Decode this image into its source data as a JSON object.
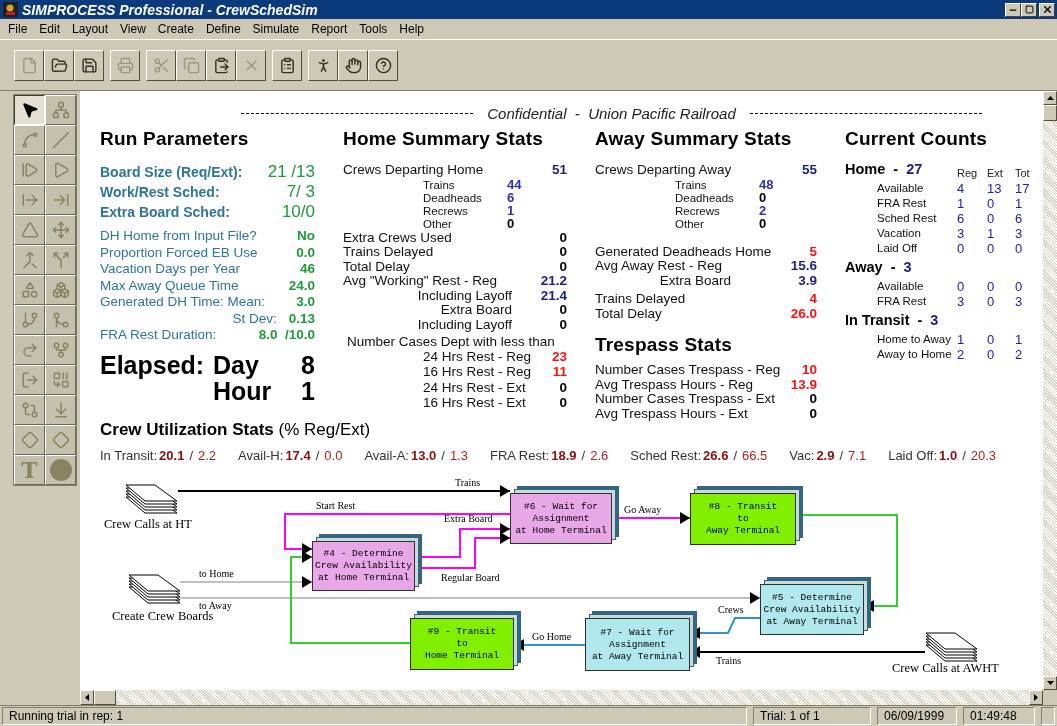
{
  "window": {
    "title": "SIMPROCESS Professional - CrewSchedSim"
  },
  "menu": [
    "File",
    "Edit",
    "Layout",
    "View",
    "Create",
    "Define",
    "Simulate",
    "Report",
    "Tools",
    "Help"
  ],
  "toolbar": [
    [
      {
        "kind": "new",
        "disabled": true
      },
      {
        "kind": "open",
        "disabled": false
      },
      {
        "kind": "save",
        "disabled": false
      }
    ],
    [
      {
        "kind": "print",
        "disabled": true
      }
    ],
    [
      {
        "kind": "cut",
        "disabled": true
      },
      {
        "kind": "copy",
        "disabled": true
      },
      {
        "kind": "paste",
        "disabled": false
      },
      {
        "kind": "delete",
        "disabled": true
      }
    ],
    [
      {
        "kind": "properties",
        "disabled": false
      }
    ],
    [
      {
        "kind": "run",
        "disabled": false
      },
      {
        "kind": "hand",
        "disabled": false
      },
      {
        "kind": "help",
        "disabled": false
      }
    ]
  ],
  "palette": [
    {
      "kind": "pointer",
      "selected": true
    },
    {
      "kind": "layout",
      "selected": false
    },
    {
      "kind": "connector",
      "selected": false
    },
    {
      "kind": "line",
      "selected": false
    },
    {
      "kind": "step",
      "selected": false
    },
    {
      "kind": "play",
      "selected": false
    },
    {
      "kind": "entry",
      "selected": false
    },
    {
      "kind": "exit",
      "selected": false
    },
    {
      "kind": "delay",
      "selected": false
    },
    {
      "kind": "branch",
      "selected": false
    },
    {
      "kind": "merge",
      "selected": false
    },
    {
      "kind": "split",
      "selected": false
    },
    {
      "kind": "assign",
      "selected": false
    },
    {
      "kind": "release",
      "selected": false
    },
    {
      "kind": "fork",
      "selected": false
    },
    {
      "kind": "join",
      "selected": false
    },
    {
      "kind": "get",
      "selected": false
    },
    {
      "kind": "gitfork",
      "selected": false
    },
    {
      "kind": "gate",
      "selected": false
    },
    {
      "kind": "transform",
      "selected": false
    },
    {
      "kind": "batch",
      "selected": false
    },
    {
      "kind": "dispose",
      "selected": false
    },
    {
      "kind": "decision",
      "selected": false
    },
    {
      "kind": "decision",
      "selected": false
    },
    {
      "kind": "text",
      "label": "T",
      "selected": false
    },
    {
      "kind": "circle",
      "selected": false
    }
  ],
  "canvas": {
    "banner": "Confidential  -  Union Pacific Railroad",
    "run_parameters": {
      "title": "Run Parameters",
      "main": [
        {
          "label": "Board Size (Req/Ext):",
          "value": "21 /13"
        },
        {
          "label": "Work/Rest Sched:",
          "value": "7/ 3"
        },
        {
          "label": "Extra Board Sched:",
          "value": "10/0"
        }
      ],
      "params": [
        {
          "label": "DH Home from Input File?",
          "value": "No"
        },
        {
          "label": "Proportion Forced EB Use",
          "value": "0.0"
        },
        {
          "label": "Vacation Days per Year",
          "value": "46"
        },
        {
          "label": "Max Away Queue Time",
          "value": "24.0"
        },
        {
          "label": "Generated DH Time: Mean:",
          "value": "3.0"
        },
        {
          "label": "St Dev:",
          "value": "0.13",
          "kind": "right"
        },
        {
          "label": "FRA Rest Duration:",
          "value": "8.0  /10.0"
        }
      ],
      "elapsed": [
        {
          "label": "Elapsed:",
          "unit": "Day",
          "value": "8"
        },
        {
          "unit": "Hour",
          "value": "1"
        }
      ]
    },
    "home_summary": {
      "title": "Home Summary Stats",
      "groups": [
        [
          {
            "kind": "main",
            "label": "Crews Departing Home",
            "value": "51",
            "color": "#1c1c8c"
          },
          {
            "kind": "sub",
            "label": "Trains",
            "value": "44",
            "color": "#3030b0"
          },
          {
            "kind": "sub",
            "label": "Deadheads",
            "value": "6",
            "color": "#3030b0"
          },
          {
            "kind": "sub",
            "label": "Recrews",
            "value": "1",
            "color": "#3030b0"
          },
          {
            "kind": "sub",
            "label": "Other",
            "value": "0",
            "color": "#000000"
          }
        ],
        [
          {
            "kind": "main",
            "label": "Extra Crews Used",
            "value": "0",
            "color": "#000000"
          },
          {
            "kind": "main",
            "label": "Trains Delayed",
            "value": "0",
            "color": "#000000"
          },
          {
            "kind": "main",
            "label": "Total Delay",
            "value": "0",
            "color": "#000000"
          },
          {
            "kind": "main",
            "label": "Avg \"Working\" Rest - Reg",
            "value": "21.2",
            "color": "#1c1c8c"
          },
          {
            "kind": "indent",
            "label": "Including Layoff",
            "value": "21.4",
            "color": "#1c1c8c"
          },
          {
            "kind": "indent",
            "label": "Extra Board",
            "value": "0",
            "color": "#000000"
          },
          {
            "kind": "indent",
            "label": "Including Layoff",
            "value": "0",
            "color": "#000000"
          }
        ],
        [
          {
            "kind": "note",
            "label": "Number Cases Dept with less than"
          },
          {
            "kind": "deep",
            "label": "24 Hrs Rest - Reg",
            "value": "23",
            "color": "#ff1010"
          },
          {
            "kind": "deep",
            "label": "16 Hrs Rest - Reg",
            "value": "11",
            "color": "#ff1010"
          },
          {
            "kind": "deep",
            "label": "24 Hrs Rest - Ext",
            "value": "0",
            "color": "#000000"
          },
          {
            "kind": "deep",
            "label": "16 Hrs Rest - Ext",
            "value": "0",
            "color": "#000000"
          }
        ]
      ]
    },
    "away_summary": {
      "title": "Away Summary Stats",
      "groups": [
        [
          {
            "kind": "main",
            "label": "Crews Departing Away",
            "value": "55",
            "color": "#1c1c8c"
          },
          {
            "kind": "sub",
            "label": "Trains",
            "value": "48",
            "color": "#3030b0"
          },
          {
            "kind": "sub",
            "label": "Deadheads",
            "value": "0",
            "color": "#000000"
          },
          {
            "kind": "sub",
            "label": "Recrews",
            "value": "2",
            "color": "#3030b0"
          },
          {
            "kind": "sub",
            "label": "Other",
            "value": "0",
            "color": "#000000"
          }
        ],
        [
          {
            "kind": "main",
            "label": "Generated Deadheads Home",
            "value": "5",
            "color": "#ff1010"
          },
          {
            "kind": "main",
            "label": "Avg Away Rest - Reg",
            "value": "15.6",
            "color": "#1c1c8c"
          },
          {
            "kind": "indent",
            "label": "Extra Board",
            "value": "3.9",
            "color": "#1c1c8c"
          }
        ],
        [
          {
            "kind": "main",
            "label": "Trains Delayed",
            "value": "4",
            "color": "#ff1010"
          },
          {
            "kind": "main",
            "label": "Total Delay",
            "value": "26.0",
            "color": "#ff1010"
          }
        ]
      ]
    },
    "trespass": {
      "title": "Trespass Stats",
      "groups": [
        [
          {
            "kind": "main",
            "label": "Number Cases Trespass - Reg",
            "value": "10",
            "color": "#ff1010"
          },
          {
            "kind": "main",
            "label": "Avg Trespass Hours - Reg",
            "value": "13.9",
            "color": "#ff1010"
          },
          {
            "kind": "main",
            "label": "Number Cases Trespass - Ext",
            "value": "0",
            "color": "#000000"
          },
          {
            "kind": "main",
            "label": "Avg Trespass Hours - Ext",
            "value": "0",
            "color": "#000000"
          }
        ]
      ]
    },
    "current_counts": {
      "title": "Current Counts",
      "columns": [
        "Reg",
        "Ext",
        "Tot"
      ],
      "groups": [
        {
          "name": "Home",
          "dash": "-",
          "count": "27",
          "rows": [
            {
              "label": "Available",
              "values": [
                "4",
                "13",
                "17"
              ]
            },
            {
              "label": "FRA Rest",
              "values": [
                "1",
                "0",
                "1"
              ]
            },
            {
              "label": "Sched Rest",
              "values": [
                "6",
                "0",
                "6"
              ]
            },
            {
              "label": "Vacation",
              "values": [
                "3",
                "1",
                "3"
              ]
            },
            {
              "label": "Laid Off",
              "values": [
                "0",
                "0",
                "0"
              ]
            }
          ]
        },
        {
          "name": "Away",
          "dash": "-",
          "count": "3",
          "rows": [
            {
              "label": "Available",
              "values": [
                "0",
                "0",
                "0"
              ]
            },
            {
              "label": "FRA Rest",
              "values": [
                "3",
                "0",
                "3"
              ]
            }
          ]
        },
        {
          "name": "In Transit",
          "dash": "-",
          "count": "3",
          "rows": [
            {
              "label": "Home to Away",
              "values": [
                "1",
                "0",
                "1"
              ]
            },
            {
              "label": "Away to Home",
              "values": [
                "2",
                "0",
                "2"
              ]
            }
          ]
        }
      ]
    },
    "utilization": {
      "title": "**Crew Utilization Stats** (% Reg/Ext)",
      "items": [
        {
          "label": "In Transit:",
          "reg": "20.1",
          "sep": "/",
          "ext": "2.2"
        },
        {
          "label": "Avail-H:",
          "reg": "17.4",
          "sep": "/",
          "ext": "0.0"
        },
        {
          "label": "Avail-A:",
          "reg": "13.0",
          "sep": "/",
          "ext": "1.3"
        },
        {
          "label": "FRA Rest:",
          "reg": "18.9",
          "sep": "/",
          "ext": "2.6"
        },
        {
          "label": "Sched Rest:",
          "reg": "26.6",
          "sep": "/",
          "ext": "66.5"
        },
        {
          "label": "Vac:",
          "reg": "2.9",
          "sep": "/",
          "ext": "7.1"
        },
        {
          "label": "Laid Off:",
          "reg": "1.0",
          "sep": "/",
          "ext": "20.3"
        }
      ]
    },
    "diagram": {
      "sources": [
        {
          "label": "Crew Calls at HT"
        },
        {
          "label": "Create Crew Boards"
        },
        {
          "label": "Crew Calls at AWHT"
        }
      ],
      "blocks": [
        {
          "lines": [
            "#6 - Wait for",
            "Assignment",
            "at Home Terminal"
          ],
          "color": "#e8a8e8"
        },
        {
          "lines": [
            "#8 - Transit",
            "to",
            "Away Terminal"
          ],
          "color": "#80f000"
        },
        {
          "lines": [
            "#4 - Determine",
            "Crew Availability",
            "at Home Terminal"
          ],
          "color": "#e8a8e8"
        },
        {
          "lines": [
            "#5 - Determine",
            "Crew Availability",
            "at Away Terminal"
          ],
          "color": "#b0e8ee"
        },
        {
          "lines": [
            "#9 - Transit",
            "to",
            "Home Terminal"
          ],
          "color": "#80f000"
        },
        {
          "lines": [
            "#7 - Wait for",
            "Assignment",
            "at Away Terminal"
          ],
          "color": "#b0e8ee"
        }
      ],
      "connectors": [
        {
          "label": "Trains",
          "color": "#000000"
        },
        {
          "label": "Start Rest",
          "color": "#ff00ff"
        },
        {
          "label": "Extra Board",
          "color": "#ff00ff"
        },
        {
          "label": "Regular Board",
          "color": "#ff00ff"
        },
        {
          "label": "Go Away",
          "color": "#ff00ff"
        },
        {
          "label": "to Home",
          "color": "#c0c0c0"
        },
        {
          "label": "to Away",
          "color": "#c0c0c0"
        },
        {
          "color": "#30d030"
        },
        {
          "label": "Crews",
          "color": "#3090d0"
        },
        {
          "label": "Go Home",
          "color": "#3090d0"
        },
        {
          "label": "Trains",
          "color": "#000000"
        },
        {
          "color": "#30d030"
        }
      ]
    }
  },
  "status_bar": {
    "message": "Running trial in rep: 1",
    "trial": "Trial: 1 of 1",
    "date": "06/09/1999",
    "time": "01:49:48"
  }
}
